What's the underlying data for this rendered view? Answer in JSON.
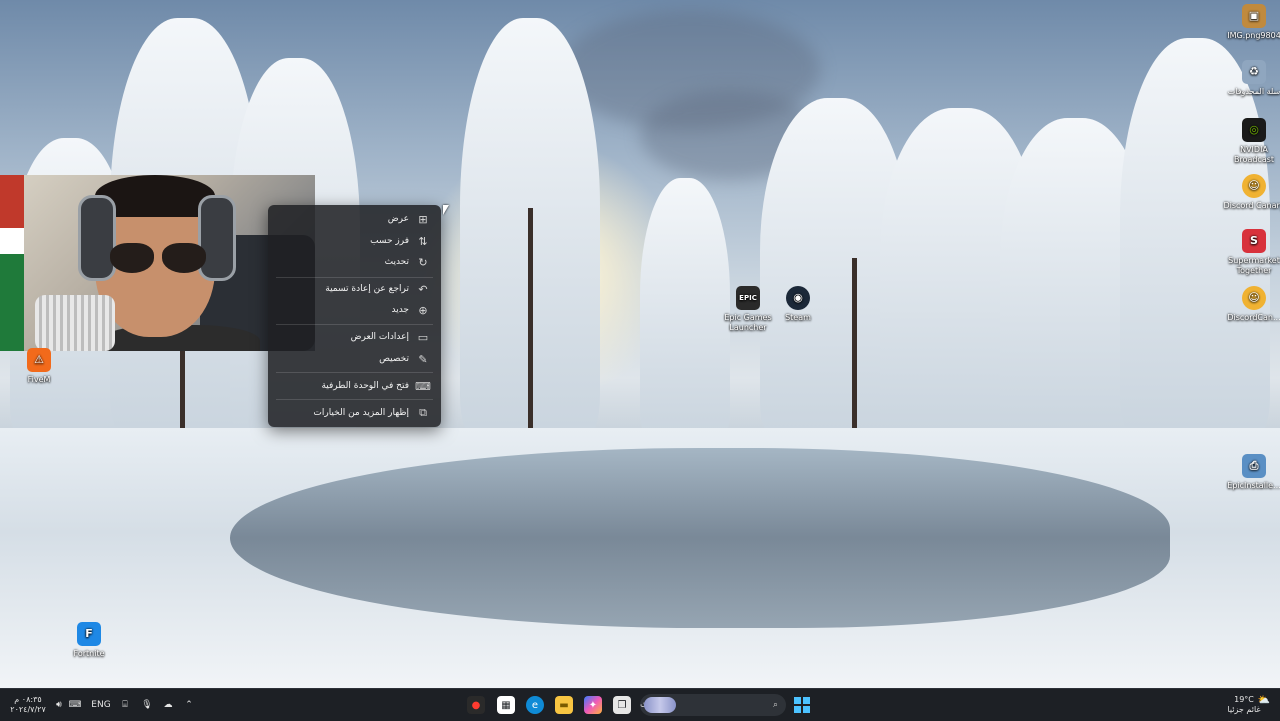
{
  "desktop": {
    "icons_left": [
      {
        "label": "FiveM",
        "icon": "fivem-icon",
        "color": "#f26a1b"
      },
      {
        "label": "Fortnite",
        "icon": "fortnite-icon",
        "color": "#1e88e5"
      }
    ],
    "icons_middle": [
      {
        "label": "Epic Games Launcher",
        "icon": "epic-games-icon",
        "color": "#2a2a2a"
      },
      {
        "label": "Steam",
        "icon": "steam-icon",
        "color": "#1b2838"
      }
    ],
    "icons_right": [
      {
        "label": "IMG.png9804",
        "icon": "image-file-icon",
        "color": "#c08a3e"
      },
      {
        "label": "سلة المحذوفات",
        "icon": "recycle-bin-icon",
        "color": "#8fa6bf"
      },
      {
        "label": "NVIDIA Broadcast",
        "icon": "nvidia-icon",
        "color": "#76b900"
      },
      {
        "label": "Discord Canary",
        "icon": "discord-canary-icon",
        "color": "#f0b232"
      },
      {
        "label": "Supermarket Together",
        "icon": "supermarket-icon",
        "color": "#d8323c"
      },
      {
        "label": "DiscordCan...",
        "icon": "discord-canary-icon",
        "color": "#f0b232"
      },
      {
        "label": "EpicInstalle...",
        "icon": "installer-icon",
        "color": "#5a8fc4"
      }
    ]
  },
  "context_menu": {
    "items": [
      {
        "label": "عرض",
        "icon": "view-grid-icon",
        "glyph": "⊞"
      },
      {
        "label": "فرز حسب",
        "icon": "sort-icon",
        "glyph": "⇅"
      },
      {
        "label": "تحديث",
        "icon": "refresh-icon",
        "glyph": "↻"
      },
      {
        "label": "تراجع عن إعادة تسمية",
        "icon": "undo-icon",
        "glyph": "↶"
      },
      {
        "label": "جديد",
        "icon": "new-plus-icon",
        "glyph": "⊕"
      },
      {
        "label": "إعدادات العرض",
        "icon": "display-settings-icon",
        "glyph": "▭"
      },
      {
        "label": "تخصيص",
        "icon": "personalize-pen-icon",
        "glyph": "✎"
      },
      {
        "label": "فتح في الوحدة الطرفية",
        "icon": "terminal-icon",
        "glyph": "⌨"
      },
      {
        "label": "إظهار المزيد من الخيارات",
        "icon": "more-options-icon",
        "glyph": "⧉"
      }
    ]
  },
  "taskbar": {
    "search_placeholder": "بحث",
    "language": "ENG",
    "clock_time": "٠٨:٣٥ م",
    "clock_date": "٢٠٢٤/٧/٢٧",
    "weather_temp": "19°C",
    "weather_text": "غائم جزئيا",
    "accent": "#4cc2ff"
  }
}
